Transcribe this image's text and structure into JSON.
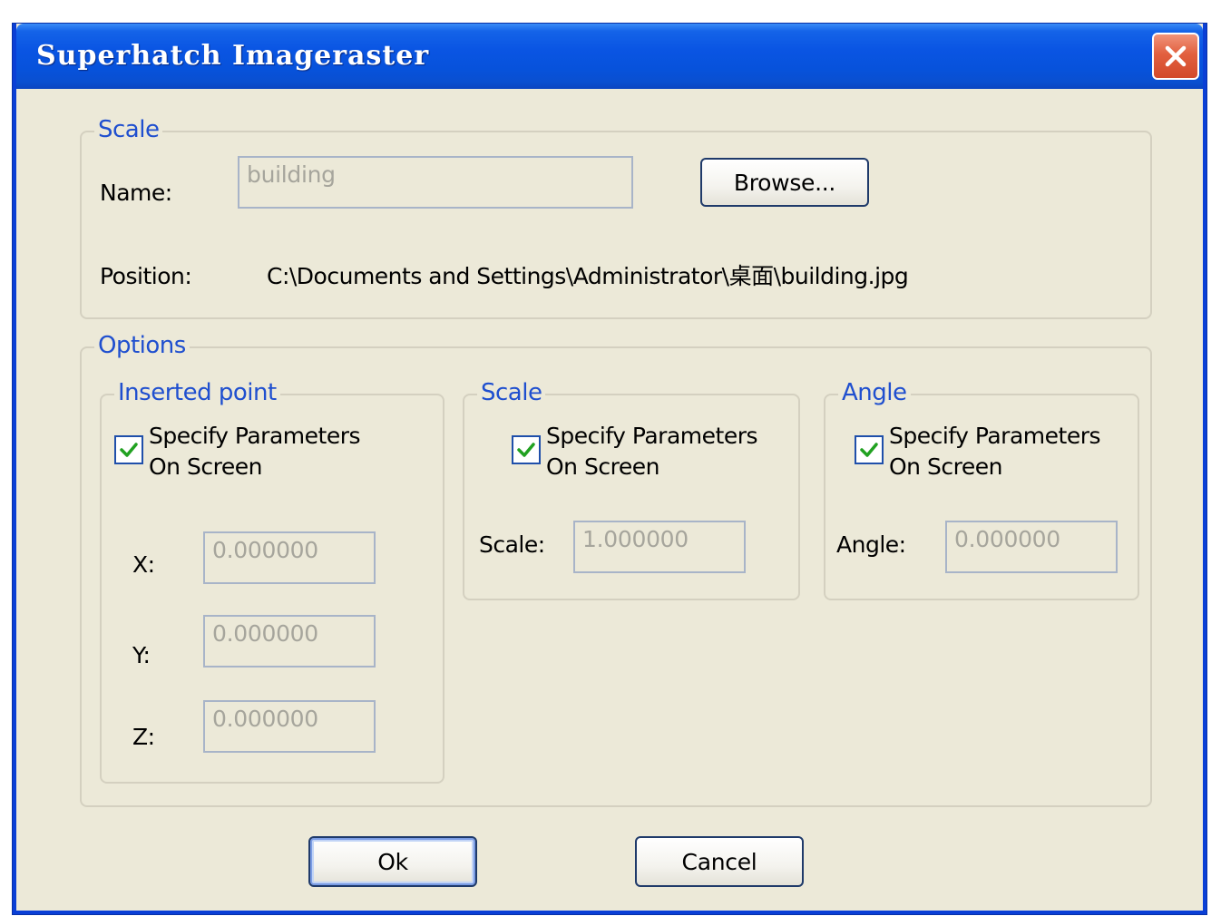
{
  "window": {
    "title": "Superhatch Imageraster"
  },
  "scale_group": {
    "legend": "Scale",
    "name_label": "Name:",
    "name_value": "building",
    "browse_label": "Browse...",
    "position_label": "Position:",
    "position_value": "C:\\Documents and Settings\\Administrator\\桌面\\building.jpg"
  },
  "options_group": {
    "legend": "Options",
    "inserted_point": {
      "legend": "Inserted point",
      "checkbox_line1": "Specify Parameters",
      "checkbox_line2": "On Screen",
      "checked": true,
      "x_label": "X:",
      "x_value": "0.000000",
      "y_label": "Y:",
      "y_value": "0.000000",
      "z_label": "Z:",
      "z_value": "0.000000"
    },
    "scale": {
      "legend": "Scale",
      "checkbox_line1": "Specify Parameters",
      "checkbox_line2": "On Screen",
      "checked": true,
      "scale_label": "Scale:",
      "scale_value": "1.000000"
    },
    "angle": {
      "legend": "Angle",
      "checkbox_line1": "Specify Parameters",
      "checkbox_line2": "On Screen",
      "checked": true,
      "angle_label": "Angle:",
      "angle_value": "0.000000"
    }
  },
  "footer": {
    "ok_label": "Ok",
    "cancel_label": "Cancel"
  },
  "colors": {
    "titlebar": "#0a55e3",
    "legend_text": "#1f4fcf",
    "dialog_bg": "#ece9d8",
    "close_button": "#e2603f",
    "checkmark": "#21a121"
  },
  "icons": {
    "close": "close-icon",
    "check": "checkmark-icon"
  }
}
